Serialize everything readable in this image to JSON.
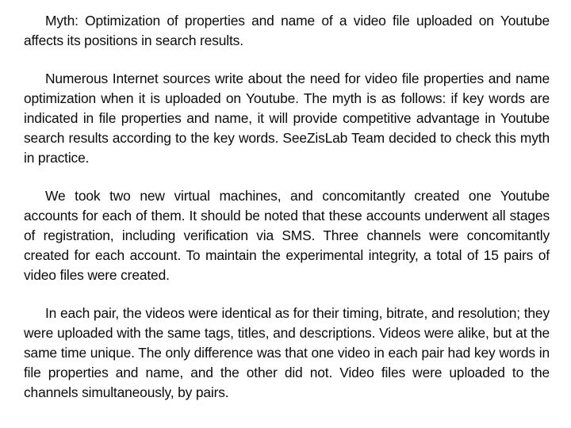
{
  "document": {
    "background_color": "#ffffff",
    "text_color": "#0b0b0b",
    "paragraphs": [
      {
        "id": "myth-statement",
        "text": "Myth: Optimization of properties and name of a video file uploaded on Youtube affects its positions in search results."
      },
      {
        "id": "myth-background",
        "text": "Numerous Internet sources write about the need for video file properties and name optimization when it is uploaded on Youtube. The myth is as follows: if key words are indicated in file properties and name, it will provide competitive advantage in Youtube search results according to the key words. SeeZisLab Team decided to check this myth in practice."
      },
      {
        "id": "experiment-setup",
        "text": "We took two new virtual machines, and concomitantly created one Youtube accounts for each of them. It should be noted that these accounts underwent all stages of registration, including verification via SMS. Three channels were concomitantly created for each account. To maintain the experimental integrity, a total of 15 pairs of video files were created."
      },
      {
        "id": "experiment-method",
        "text": "In each pair, the videos were identical as for their timing, bitrate, and resolution; they were uploaded with the same tags, titles, and descriptions. Videos were alike, but at the same time unique. The only difference was that one video in each pair had key words in file properties and name, and the other did not. Video files were uploaded to the channels simultaneously, by pairs."
      }
    ]
  }
}
